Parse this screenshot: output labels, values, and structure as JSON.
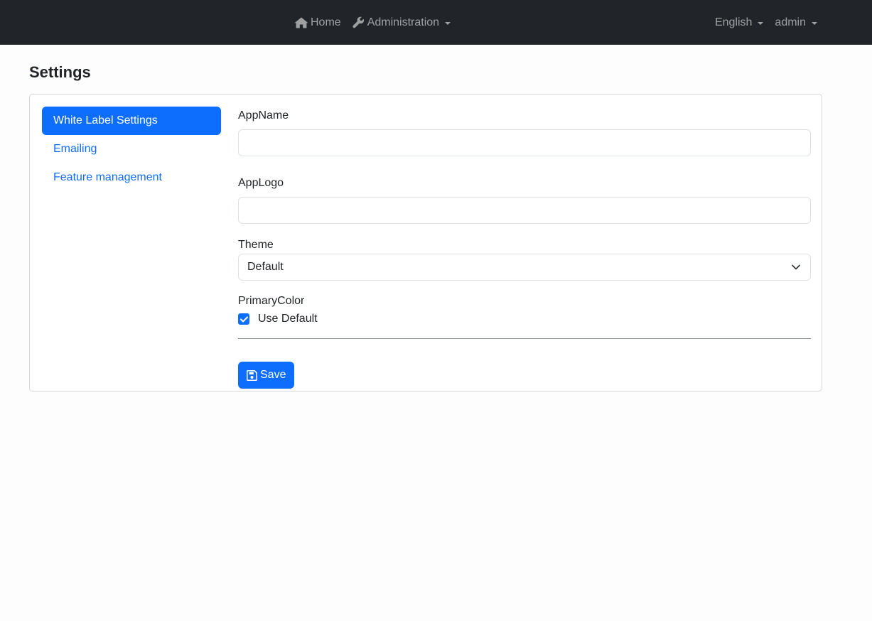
{
  "navbar": {
    "home_label": "Home",
    "admin_label": "Administration",
    "language_label": "English",
    "user_label": "admin"
  },
  "page": {
    "title": "Settings"
  },
  "tabs": [
    {
      "label": "White Label Settings",
      "active": true
    },
    {
      "label": "Emailing",
      "active": false
    },
    {
      "label": "Feature management",
      "active": false
    }
  ],
  "form": {
    "app_name_label": "AppName",
    "app_name_value": "",
    "app_logo_label": "AppLogo",
    "app_logo_value": "",
    "theme_label": "Theme",
    "theme_selected": "Default",
    "primary_color_label": "PrimaryColor",
    "use_default_label": "Use Default",
    "use_default_checked": true,
    "save_label": "Save"
  },
  "colors": {
    "navbar_bg": "#212529",
    "primary": "#0d6efd"
  },
  "icons": {
    "home": "home-icon",
    "admin": "wrench-icon",
    "save": "floppy-disk-icon",
    "select": "chevron-down-icon",
    "check": "check-icon"
  }
}
